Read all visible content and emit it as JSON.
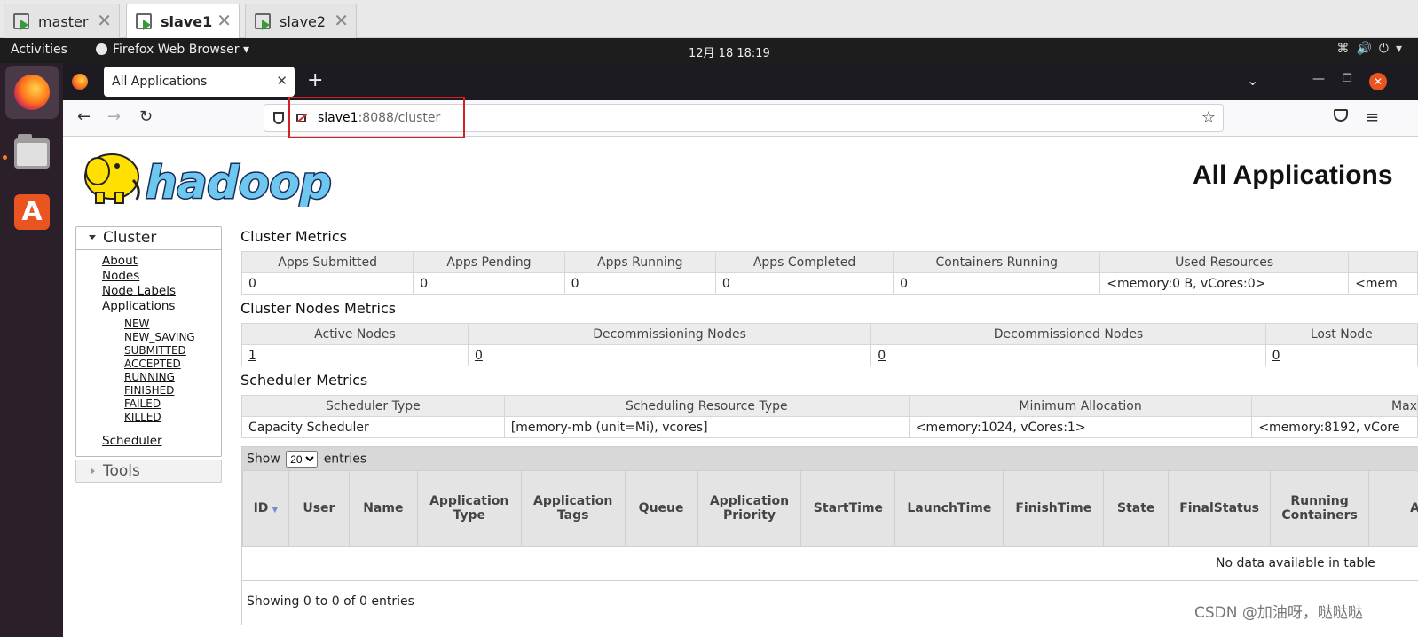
{
  "vm_tabs": [
    {
      "label": "master",
      "active": false
    },
    {
      "label": "slave1",
      "active": true
    },
    {
      "label": "slave2",
      "active": false
    }
  ],
  "topbar": {
    "activities": "Activities",
    "app": "Firefox Web Browser ▾",
    "clock": "12月 18  18:19"
  },
  "browser": {
    "tab_title": "All Applications",
    "url_host": "slave1",
    "url_path": ":8088/cluster"
  },
  "page": {
    "logo_text": "hadoop",
    "title": "All Applications"
  },
  "sidebar": {
    "cluster_label": "Cluster",
    "links": [
      "About",
      "Nodes",
      "Node Labels",
      "Applications"
    ],
    "app_states": [
      "NEW",
      "NEW_SAVING",
      "SUBMITTED",
      "ACCEPTED",
      "RUNNING",
      "FINISHED",
      "FAILED",
      "KILLED"
    ],
    "scheduler": "Scheduler",
    "tools_label": "Tools"
  },
  "cluster_metrics": {
    "title": "Cluster Metrics",
    "headers": [
      "Apps Submitted",
      "Apps Pending",
      "Apps Running",
      "Apps Completed",
      "Containers Running",
      "Used Resources",
      ""
    ],
    "values": [
      "0",
      "0",
      "0",
      "0",
      "0",
      "<memory:0 B, vCores:0>",
      "<mem"
    ]
  },
  "nodes_metrics": {
    "title": "Cluster Nodes Metrics",
    "headers": [
      "Active Nodes",
      "Decommissioning Nodes",
      "Decommissioned Nodes",
      "Lost Node"
    ],
    "values": [
      "1",
      "0",
      "0",
      "0"
    ]
  },
  "scheduler_metrics": {
    "title": "Scheduler Metrics",
    "headers": [
      "Scheduler Type",
      "Scheduling Resource Type",
      "Minimum Allocation",
      "Max"
    ],
    "values": [
      "Capacity Scheduler",
      "[memory-mb (unit=Mi), vcores]",
      "<memory:1024, vCores:1>",
      "<memory:8192, vCore"
    ]
  },
  "apps_table": {
    "show_label": "Show",
    "page_size": "20",
    "entries_label": "entries",
    "columns": [
      "ID",
      "User",
      "Name",
      "Application Type",
      "Application Tags",
      "Queue",
      "Application Priority",
      "StartTime",
      "LaunchTime",
      "FinishTime",
      "State",
      "FinalStatus",
      "Running Containers",
      "A"
    ],
    "empty_text": "No data available in table",
    "info": "Showing 0 to 0 of 0 entries"
  },
  "watermark": "CSDN @加油呀，哒哒哒"
}
